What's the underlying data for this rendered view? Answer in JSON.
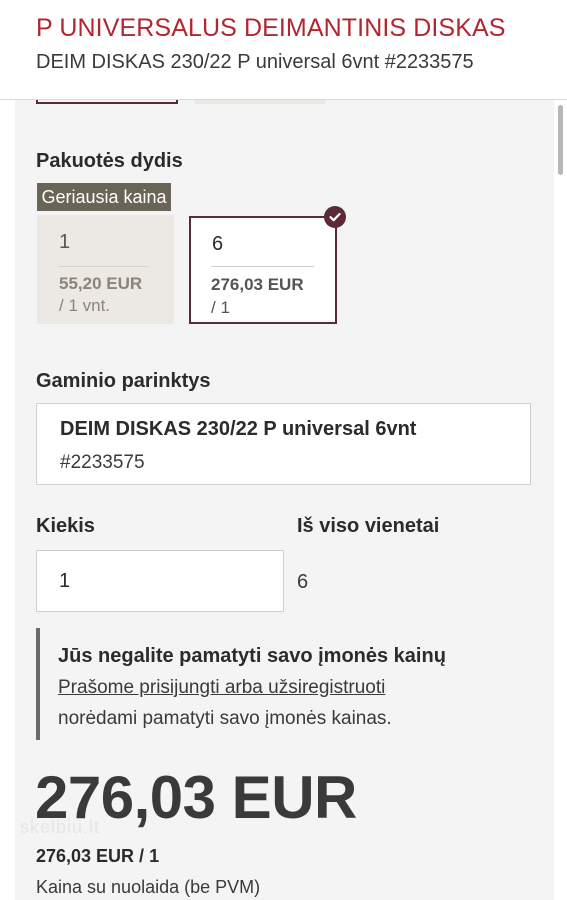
{
  "header": {
    "title": "P UNIVERSALUS DEIMANTINIS DISKAS",
    "subtitle": "DEIM DISKAS 230/22 P universal 6vnt #2233575"
  },
  "package": {
    "label": "Pakuotės dydis",
    "badge": "Geriausia kaina",
    "options": [
      {
        "qty": "1",
        "price": "55,20 EUR",
        "per": "/ 1 vnt.",
        "selected": false
      },
      {
        "qty": "6",
        "price": "276,03 EUR",
        "per": "/ 1",
        "selected": true
      }
    ]
  },
  "product_options": {
    "label": "Gaminio parinktys",
    "name": "DEIM DISKAS 230/22 P universal 6vnt",
    "code": "#2233575"
  },
  "quantity": {
    "label": "Kiekis",
    "value": "1",
    "total_label": "Iš viso vienetai",
    "total_value": "6"
  },
  "notice": {
    "title": "Jūs negalite pamatyti savo įmonės kainų",
    "link": "Prašome prisijungti arba užsiregistruoti",
    "text": "norėdami pamatyti savo įmonės kainas."
  },
  "price": {
    "total": "276,03 EUR",
    "unit": "276,03 EUR / 1",
    "note": "Kaina su nuolaida (be PVM)"
  },
  "watermark": "skelbiu.lt",
  "icons": {
    "selected": "check-icon"
  },
  "colors": {
    "brand": "#b3262f",
    "accent": "#5a2a36",
    "badge": "#6a6457",
    "panel": "#f4f4f4"
  }
}
